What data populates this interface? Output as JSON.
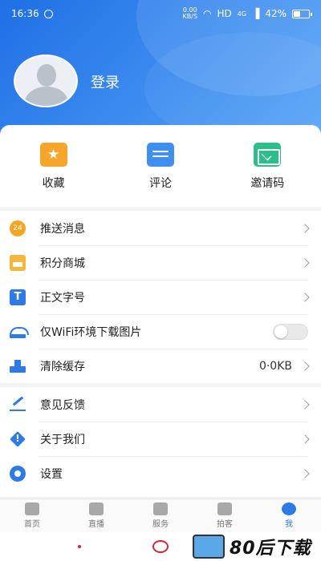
{
  "status_bar": {
    "time": "16:36",
    "net_speed_value": "0.00",
    "net_speed_unit": "KB/S",
    "hd": "HD",
    "network": "4G",
    "battery": "42%"
  },
  "profile": {
    "login_label": "登录"
  },
  "shortcuts": [
    {
      "label": "收藏",
      "icon": "favorite-icon"
    },
    {
      "label": "评论",
      "icon": "comment-icon"
    },
    {
      "label": "邀请码",
      "icon": "invite-code-icon"
    }
  ],
  "settings_group1": [
    {
      "label": "推送消息",
      "icon": "push-icon",
      "badge": "24"
    },
    {
      "label": "积分商城",
      "icon": "points-mall-icon"
    },
    {
      "label": "正文字号",
      "icon": "font-size-icon",
      "icon_text": "T"
    },
    {
      "label": "仅WiFi环境下载图片",
      "icon": "wifi-image-icon",
      "toggle": false
    },
    {
      "label": "清除缓存",
      "icon": "clear-cache-icon",
      "value": "0·0KB"
    }
  ],
  "settings_group2": [
    {
      "label": "意见反馈",
      "icon": "feedback-icon"
    },
    {
      "label": "关于我们",
      "icon": "about-icon"
    },
    {
      "label": "设置",
      "icon": "settings-icon"
    }
  ],
  "tabbar": [
    {
      "label": "首页",
      "icon": "home-icon",
      "active": false
    },
    {
      "label": "直播",
      "icon": "live-icon",
      "active": false
    },
    {
      "label": "服务",
      "icon": "service-icon",
      "active": false
    },
    {
      "label": "拍客",
      "icon": "camera-icon",
      "active": false
    },
    {
      "label": "我",
      "icon": "me-icon",
      "active": true
    }
  ],
  "watermark": {
    "text": "80后下载"
  },
  "colors": {
    "primary": "#2e7be8",
    "header_gradient_start": "#1f6fe6",
    "header_gradient_end": "#5aa6f6",
    "accent_orange": "#f7a62a",
    "accent_green": "#2cbf8b"
  }
}
